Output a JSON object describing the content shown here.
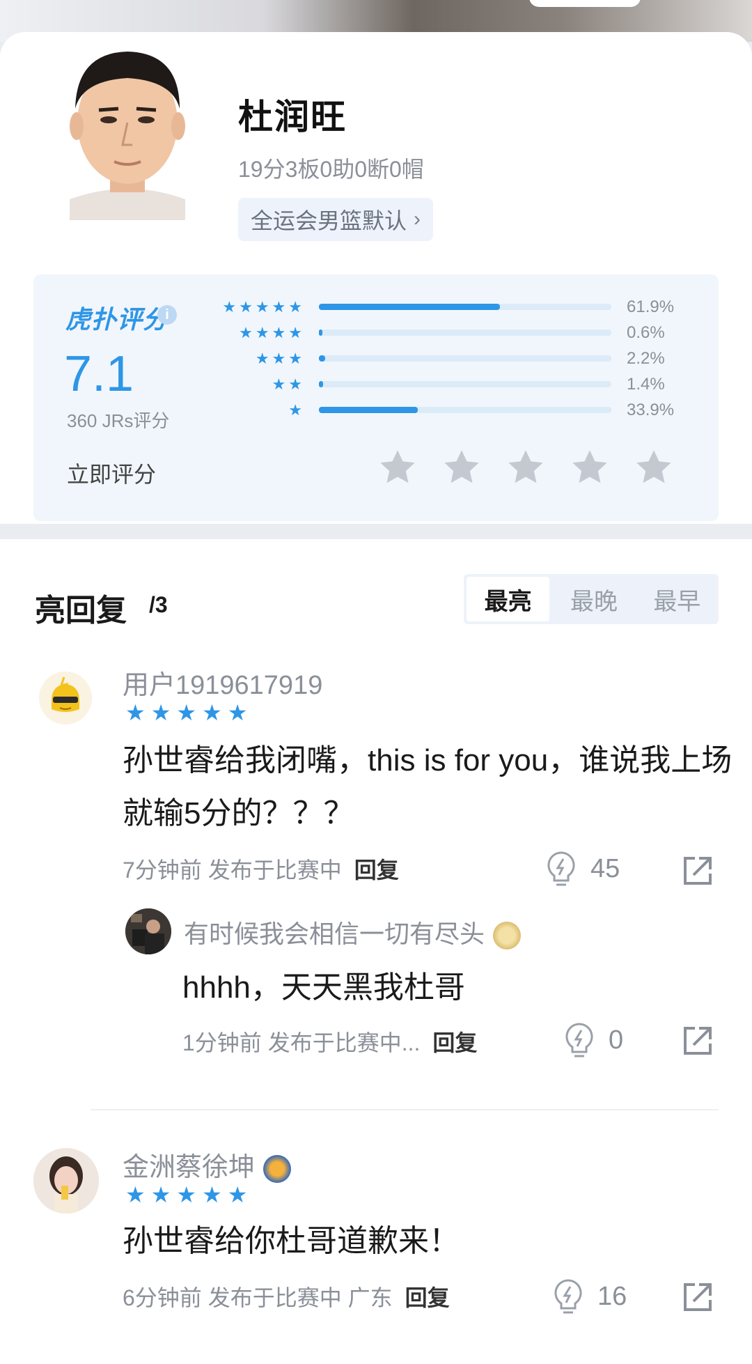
{
  "player": {
    "name": "杜润旺",
    "stats_line": "19分3板0助0断0帽",
    "tag_label": "全运会男篮默认"
  },
  "rating": {
    "brand_label": "虎扑评分",
    "score": "7.1",
    "count_label": "360 JRs评分",
    "distribution": [
      {
        "stars": "★★★★★",
        "percent": "61.9%",
        "fraction": 0.619
      },
      {
        "stars": "★★★★",
        "percent": "0.6%",
        "fraction": 0.006
      },
      {
        "stars": "★★★",
        "percent": "2.2%",
        "fraction": 0.022
      },
      {
        "stars": "★★",
        "percent": "1.4%",
        "fraction": 0.014
      },
      {
        "stars": "★",
        "percent": "33.9%",
        "fraction": 0.339
      }
    ],
    "rate_now_label": "立即评分",
    "accent_color": "#2e96e6"
  },
  "replies": {
    "title": "亮回复",
    "count": "/3",
    "sort_tabs": [
      "最亮",
      "最晚",
      "最早"
    ],
    "active_sort": "最亮",
    "items": [
      {
        "username": "用户1919617919",
        "stars": "★★★★★",
        "text": "孙世睿给我闭嘴，this is for you，谁说我上场就输5分的？？？",
        "meta": "7分钟前 发布于比赛中",
        "reply_label": "回复",
        "likes": "45",
        "sub_reply": {
          "username": "有时候我会相信一切有尽头",
          "text": "hhhh，天天黑我杜哥",
          "meta": "1分钟前 发布于比赛中...",
          "reply_label": "回复",
          "likes": "0"
        }
      },
      {
        "username": "金洲蔡徐坤",
        "stars": "★★★★★",
        "text": "孙世睿给你杜哥道歉来！",
        "meta": "6分钟前 发布于比赛中 广东",
        "reply_label": "回复",
        "likes": "16"
      }
    ]
  }
}
